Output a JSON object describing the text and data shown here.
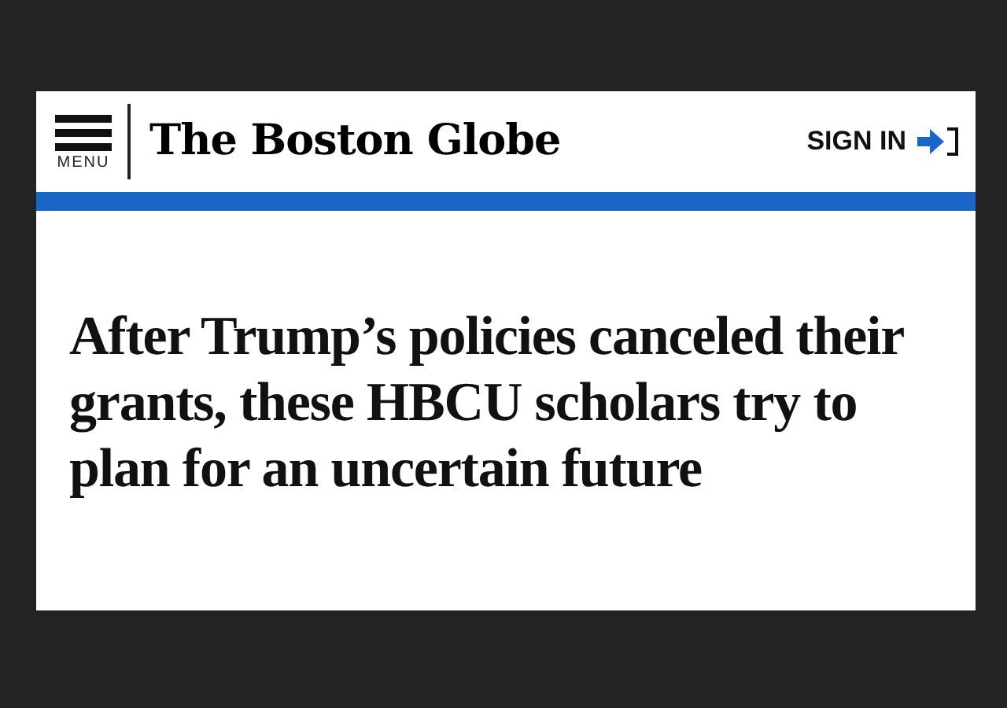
{
  "header": {
    "menu_label": "MENU",
    "logo": "The Boston Globe",
    "sign_in": "SIGN IN"
  },
  "headline": "After Trump’s policies canceled their grants, these HBCU scholars try to plan for an uncertain future"
}
